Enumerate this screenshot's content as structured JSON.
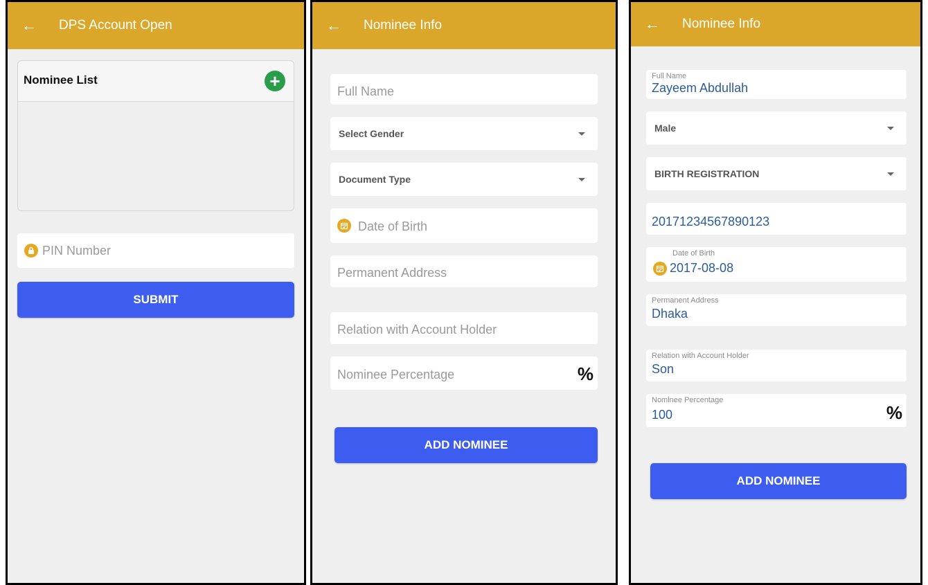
{
  "colors": {
    "appbar": "#dba72b",
    "primary": "#3d5df0",
    "add_green": "#2a9d4a",
    "icon_amber": "#e4a823",
    "value_blue": "#2a5c9a"
  },
  "screen1": {
    "title": "DPS Account Open",
    "back_icon": "arrow-left-icon",
    "nominee_list_label": "Nominee List",
    "add_icon": "plus-circle-icon",
    "pin_placeholder": "PIN Number",
    "pin_icon": "lock-icon",
    "submit_label": "SUBMIT"
  },
  "screen2": {
    "title": "Nominee Info",
    "full_name_placeholder": "Full Name",
    "gender_placeholder": "Select Gender",
    "document_type_placeholder": "Document Type",
    "dob_placeholder": "Date of Birth",
    "dob_icon": "calendar-icon",
    "address_placeholder": "Permanent Address",
    "relation_placeholder": "Relation with Account Holder",
    "percentage_placeholder": "Nominee Percentage",
    "percent_symbol": "%",
    "add_nominee_label": "ADD NOMINEE"
  },
  "screen3": {
    "title": "Nominee Info",
    "full_name_label": "Full Name",
    "full_name_value": "Zayeem Abdullah",
    "gender_value": "Male",
    "document_type_value": "BIRTH REGISTRATION",
    "document_number_value": "20171234567890123",
    "dob_label": "Date of Birth",
    "dob_value": "2017-08-08",
    "address_label": "Permanent Address",
    "address_value": "Dhaka",
    "relation_label": "Relation with Account Holder",
    "relation_value": "Son",
    "percentage_label": "Nominee Percentage",
    "percentage_value": "100",
    "percent_symbol": "%",
    "add_nominee_label": "ADD NOMINEE"
  }
}
